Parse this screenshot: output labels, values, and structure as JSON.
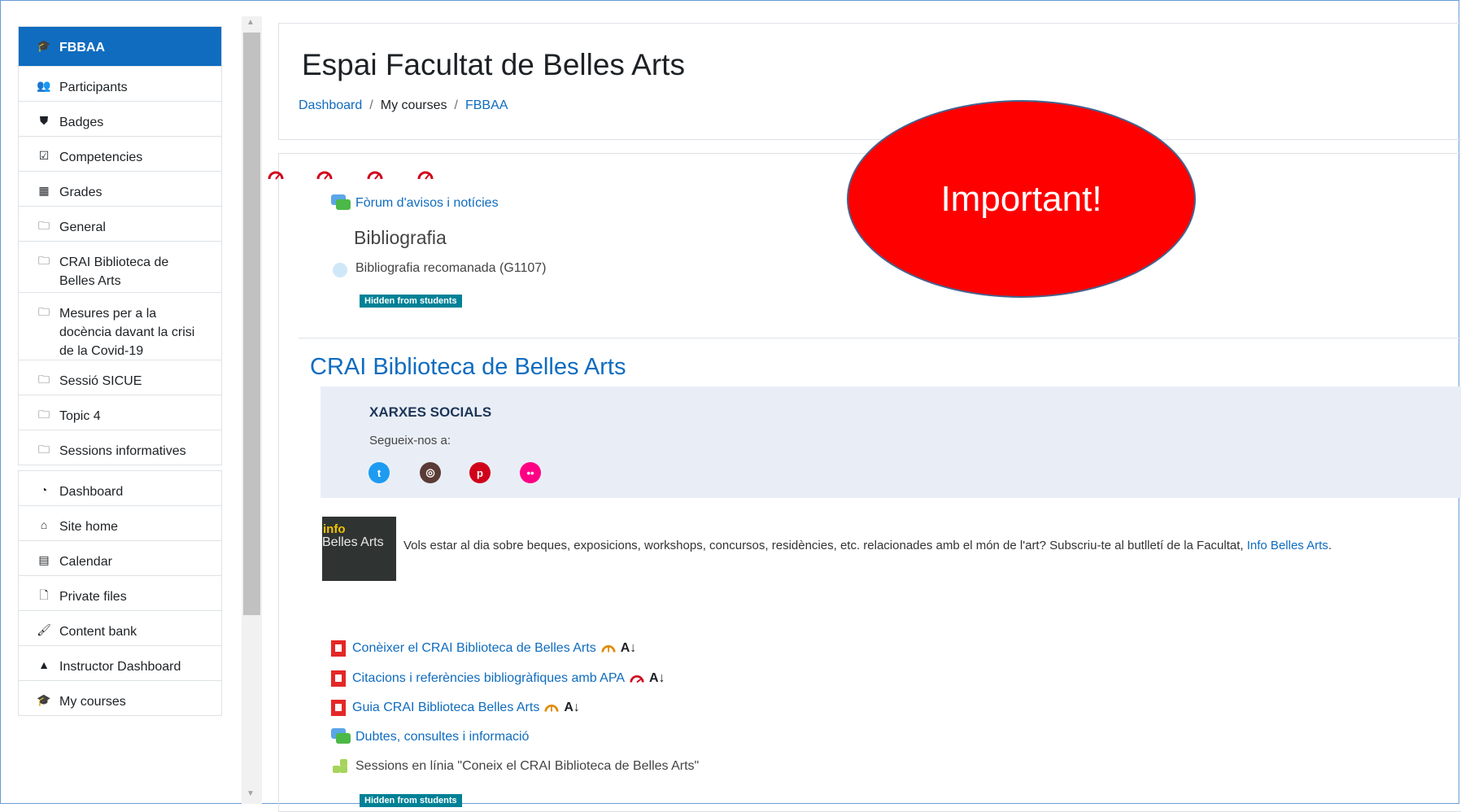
{
  "nav": {
    "group1": [
      {
        "label": "FBBAA",
        "icon": "graduation-cap-icon",
        "active": true
      },
      {
        "label": "Participants",
        "icon": "users-icon"
      },
      {
        "label": "Badges",
        "icon": "shield-icon"
      },
      {
        "label": "Competencies",
        "icon": "checkbox-icon"
      },
      {
        "label": "Grades",
        "icon": "table-icon"
      },
      {
        "label": "General",
        "icon": "folder-icon"
      },
      {
        "label": "CRAI Biblioteca de Belles Arts",
        "icon": "folder-icon"
      },
      {
        "label": "Mesures per a la docència davant la crisi de la Covid-19",
        "icon": "folder-icon"
      },
      {
        "label": "Sessió SICUE",
        "icon": "folder-icon"
      },
      {
        "label": "Topic 4",
        "icon": "folder-icon"
      },
      {
        "label": "Sessions informatives",
        "icon": "folder-icon"
      }
    ],
    "group2": [
      {
        "label": "Dashboard",
        "icon": "tachometer-icon"
      },
      {
        "label": "Site home",
        "icon": "home-icon"
      },
      {
        "label": "Calendar",
        "icon": "calendar-icon"
      },
      {
        "label": "Private files",
        "icon": "file-icon"
      },
      {
        "label": "Content bank",
        "icon": "paintbrush-icon"
      },
      {
        "label": "Instructor Dashboard",
        "icon": "area-chart-icon"
      },
      {
        "label": "My courses",
        "icon": "graduation-cap-icon"
      }
    ]
  },
  "header": {
    "title": "Espai Facultat de Belles Arts",
    "breadcrumb": [
      "Dashboard",
      "My courses",
      "FBBAA"
    ],
    "breadcrumb_sep": "/"
  },
  "general": {
    "forum": "Fòrum d'avisos i notícies",
    "label_bibliografia": "Bibliografia",
    "file": "Bibliografia recomanada (G1107)",
    "hidden_badge": "Hidden from students"
  },
  "callout": {
    "text": "Important!"
  },
  "crai": {
    "title": "CRAI Biblioteca de Belles Arts",
    "social_heading": "XARXES SOCIALS",
    "social_sub": "Segueix-nos a:",
    "info_img_line1": "info",
    "info_img_line2": "Belles Arts",
    "info_text": "Vols estar al dia sobre beques, exposicions, workshops, concursos, residències, etc. relacionades amb el món de l'art? Subscriu-te al butlletí de la Facultat, ",
    "info_link": "Info Belles Arts",
    "info_end": ".",
    "resources": [
      {
        "label": "Conèixer el CRAI Biblioteca de Belles Arts",
        "type": "pdf",
        "gauge_color": "#e08a00"
      },
      {
        "label": "Citacions i referències bibliogràfiques amb APA",
        "type": "pdf",
        "gauge_color": "#d0021b"
      },
      {
        "label": "Guia CRAI Biblioteca Belles Arts",
        "type": "pdf",
        "gauge_color": "#e08a00"
      },
      {
        "label": "Dubtes, consultes i informació",
        "type": "forum"
      },
      {
        "label": "Sessions en línia \"Coneix el CRAI Biblioteca de Belles Arts\"",
        "type": "puzzle"
      }
    ],
    "hidden_badge2": "Hidden from students"
  },
  "colors": {
    "accent": "#0f6cbf",
    "callout": "#ff0000",
    "badge": "#008196"
  }
}
